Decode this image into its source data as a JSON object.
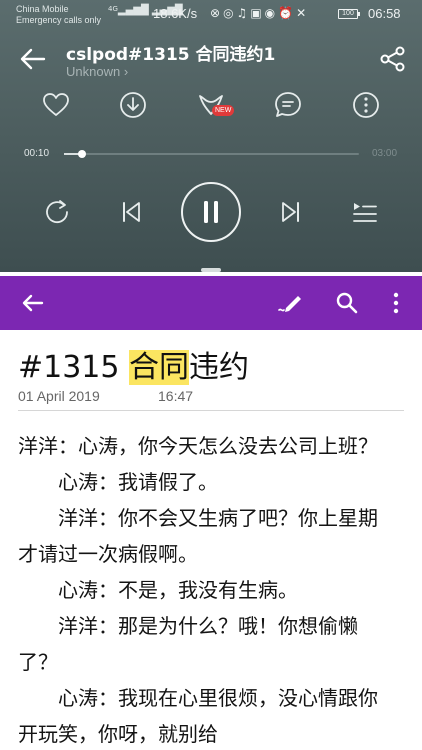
{
  "status_bar": {
    "carrier": "China Mobile",
    "emergency": "Emergency calls only",
    "signal_label": "4G",
    "net_speed": "18.6K/s",
    "battery": "100",
    "time": "06:58"
  },
  "player": {
    "title": "cslpod#1315 合同违约1",
    "artist": "Unknown",
    "new_badge": "NEW",
    "time_current": "00:10",
    "time_total": "03:00",
    "progress": 0.06,
    "colors": {
      "background": "#4e5f60",
      "accent": "#ffffff",
      "badge": "#e03a3a"
    }
  },
  "toolbar": {
    "color": "#7c27b2"
  },
  "note": {
    "title_prefix": "#1315 ",
    "title_highlight": "合同",
    "title_suffix": "违约",
    "date": "01 April 2019",
    "time": "16:47",
    "highlight_color": "#fbe561",
    "body": "洋洋：心涛，你今天怎么没去公司上班？\n　　心涛：我请假了。\n　　洋洋：你不会又生病了吧？你上星期才请过一次病假啊。\n　　心涛：不是，我没有生病。\n　　洋洋：那是为什么？哦！你想偷懒了？\n　　心涛：我现在心里很烦，没心情跟你开玩笑，你呀，就别给"
  }
}
